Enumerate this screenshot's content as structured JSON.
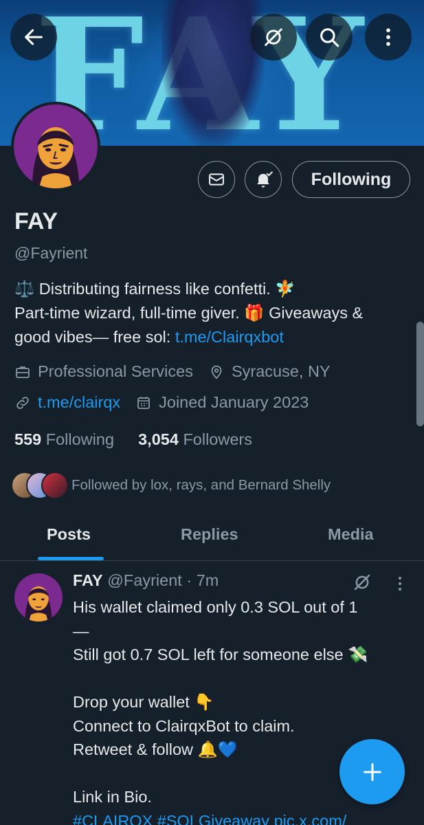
{
  "banner": {
    "word": "FAY"
  },
  "header": {
    "back_icon": "arrow-left-icon",
    "grok_icon": "grok-slash-icon",
    "search_icon": "search-icon",
    "more_icon": "vertical-dots-icon"
  },
  "actions": {
    "message_icon": "envelope-icon",
    "notify_icon": "bell-check-icon",
    "following_label": "Following"
  },
  "profile": {
    "name": "FAY",
    "handle": "@Fayrient",
    "bio_lines": [
      "⚖️ Distributing fairness like confetti. 🧚",
      "Part-time wizard, full-time giver. 🎁 Giveaways &",
      "good vibes— free sol: "
    ],
    "bio_link": "t.me/Clairqxbot",
    "category": "Professional Services",
    "location": "Syracuse, NY",
    "website": "t.me/clairqx",
    "joined": "Joined January 2023",
    "following_count": "559",
    "following_label": "Following",
    "followers_count": "3,054",
    "followers_label": "Followers",
    "followed_by": "Followed by lox, rays, and Bernard Shelly"
  },
  "tabs": [
    "Posts",
    "Replies",
    "Media"
  ],
  "tweet": {
    "name": "FAY",
    "handle_time": "@Fayrient · 7m",
    "lines": [
      "His wallet claimed only 0.3 SOL out of 1",
      "—",
      "Still got 0.7 SOL left for someone else 💸",
      "",
      "Drop your wallet 👇",
      "Connect to ClairqxBot to claim.",
      "Retweet & follow 🔔💙",
      "",
      "Link in Bio."
    ],
    "hashtags_line": "#CLAIRQX #SOLGiveaway pic.x.com/"
  },
  "fab": {
    "icon": "plus-icon"
  },
  "colors": {
    "background": "#15202b",
    "accent": "#1d9bf0",
    "muted": "#8b98a5",
    "text": "#e7e9ea"
  }
}
